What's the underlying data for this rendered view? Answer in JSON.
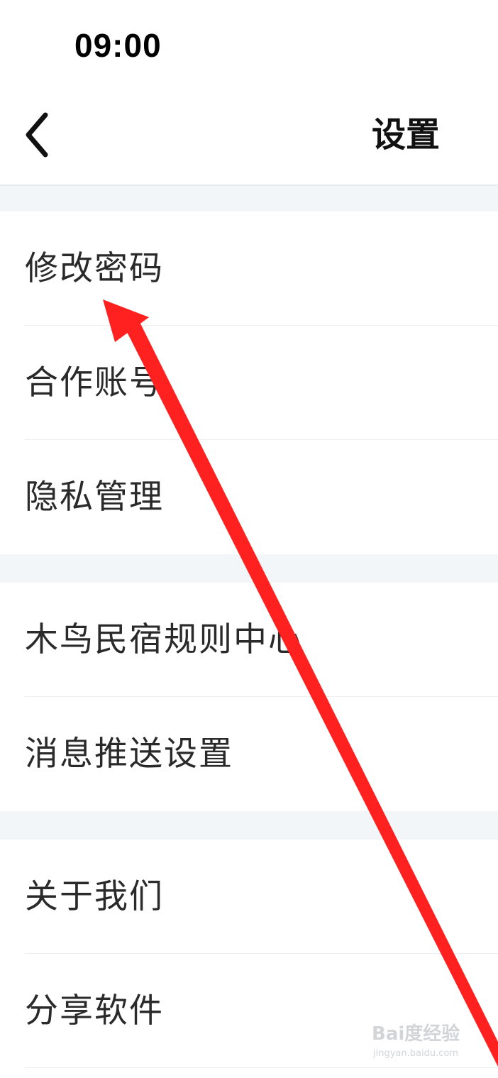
{
  "status_bar": {
    "time": "09:00"
  },
  "nav": {
    "title": "设置",
    "back_icon": "chevron-left-icon"
  },
  "sections": [
    {
      "items": [
        {
          "label": "修改密码"
        },
        {
          "label": "合作账号"
        },
        {
          "label": "隐私管理"
        }
      ]
    },
    {
      "items": [
        {
          "label": "木鸟民宿规则中心"
        },
        {
          "label": "消息推送设置"
        }
      ]
    },
    {
      "items": [
        {
          "label": "关于我们"
        },
        {
          "label": "分享软件"
        }
      ]
    }
  ],
  "annotation": {
    "arrow_color": "#ff2020"
  },
  "watermark": {
    "logo": "Bai度经验",
    "url": "jingyan.baidu.com"
  },
  "colors": {
    "background": "#ffffff",
    "section_gap": "#f3f6f8",
    "text": "#2a2a2a"
  }
}
